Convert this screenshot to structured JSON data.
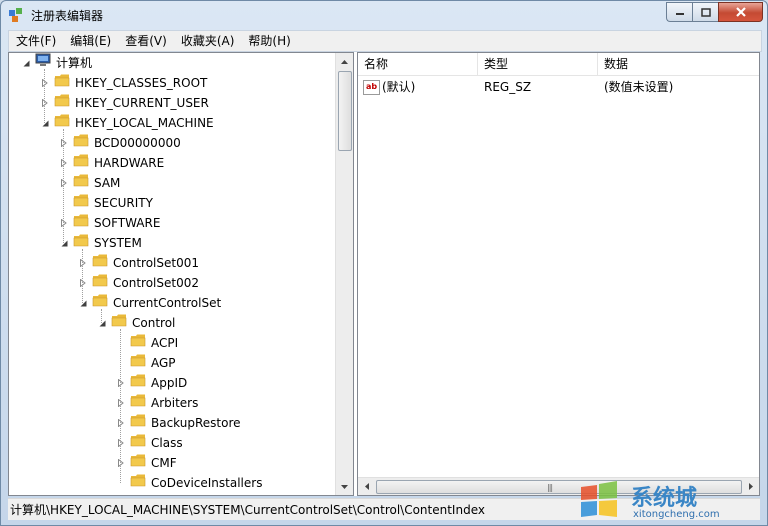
{
  "window": {
    "title": "注册表编辑器"
  },
  "menu": [
    "文件(F)",
    "编辑(E)",
    "查看(V)",
    "收藏夹(A)",
    "帮助(H)"
  ],
  "tree": [
    {
      "label": "计算机",
      "level": 0,
      "expander": "expanded",
      "icon": "computer-icon"
    },
    {
      "label": "HKEY_CLASSES_ROOT",
      "level": 1,
      "expander": "collapsed",
      "icon": "folder-icon"
    },
    {
      "label": "HKEY_CURRENT_USER",
      "level": 1,
      "expander": "collapsed",
      "icon": "folder-icon"
    },
    {
      "label": "HKEY_LOCAL_MACHINE",
      "level": 1,
      "expander": "expanded",
      "icon": "folder-icon"
    },
    {
      "label": "BCD00000000",
      "level": 2,
      "expander": "collapsed",
      "icon": "folder-icon"
    },
    {
      "label": "HARDWARE",
      "level": 2,
      "expander": "collapsed",
      "icon": "folder-icon"
    },
    {
      "label": "SAM",
      "level": 2,
      "expander": "collapsed",
      "icon": "folder-icon"
    },
    {
      "label": "SECURITY",
      "level": 2,
      "expander": "none",
      "icon": "folder-icon"
    },
    {
      "label": "SOFTWARE",
      "level": 2,
      "expander": "collapsed",
      "icon": "folder-icon"
    },
    {
      "label": "SYSTEM",
      "level": 2,
      "expander": "expanded",
      "icon": "folder-icon"
    },
    {
      "label": "ControlSet001",
      "level": 3,
      "expander": "collapsed",
      "icon": "folder-icon"
    },
    {
      "label": "ControlSet002",
      "level": 3,
      "expander": "collapsed",
      "icon": "folder-icon"
    },
    {
      "label": "CurrentControlSet",
      "level": 3,
      "expander": "expanded",
      "icon": "folder-icon"
    },
    {
      "label": "Control",
      "level": 4,
      "expander": "expanded",
      "icon": "folder-icon"
    },
    {
      "label": "ACPI",
      "level": 5,
      "expander": "none",
      "icon": "folder-icon"
    },
    {
      "label": "AGP",
      "level": 5,
      "expander": "none",
      "icon": "folder-icon"
    },
    {
      "label": "AppID",
      "level": 5,
      "expander": "collapsed",
      "icon": "folder-icon"
    },
    {
      "label": "Arbiters",
      "level": 5,
      "expander": "collapsed",
      "icon": "folder-icon"
    },
    {
      "label": "BackupRestore",
      "level": 5,
      "expander": "collapsed",
      "icon": "folder-icon"
    },
    {
      "label": "Class",
      "level": 5,
      "expander": "collapsed",
      "icon": "folder-icon"
    },
    {
      "label": "CMF",
      "level": 5,
      "expander": "collapsed",
      "icon": "folder-icon"
    },
    {
      "label": "CoDeviceInstallers",
      "level": 5,
      "expander": "none",
      "icon": "folder-icon"
    }
  ],
  "values_panel": {
    "columns": [
      "名称",
      "类型",
      "数据"
    ],
    "rows": [
      {
        "name": "(默认)",
        "type": "REG_SZ",
        "data": "(数值未设置)",
        "icon": "string-value-icon"
      }
    ]
  },
  "status": {
    "path": "计算机\\HKEY_LOCAL_MACHINE\\SYSTEM\\CurrentControlSet\\Control\\ContentIndex"
  },
  "watermark": {
    "brand": "系统城",
    "url": "xitongcheng.com"
  },
  "colors": {
    "folder": "#f2c94c",
    "close_button": "#c44a33",
    "accent": "#6f8aa6"
  }
}
